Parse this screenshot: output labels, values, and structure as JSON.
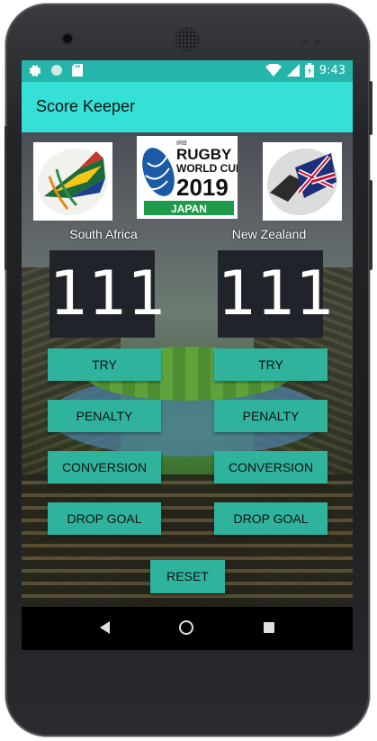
{
  "status_bar": {
    "time": "9:43",
    "left_icons": [
      "gear-icon",
      "circle-icon",
      "sd-card-icon"
    ],
    "right_icons": [
      "wifi-icon",
      "signal-icon",
      "battery-icon"
    ]
  },
  "app_bar": {
    "title": "Score Keeper"
  },
  "logos": {
    "center_lines": [
      "IRB",
      "RUGBY",
      "WORLD CUP",
      "2019",
      "JAPAN"
    ]
  },
  "teams": [
    {
      "name": "South Africa",
      "score": "111"
    },
    {
      "name": "New Zealand",
      "score": "111"
    }
  ],
  "buttons": {
    "try": "TRY",
    "penalty": "PENALTY",
    "conversion": "CONVERSION",
    "drop_goal": "DROP GOAL",
    "reset": "RESET"
  },
  "colors": {
    "status_bar": "#26b5aa",
    "app_bar": "#35e1d6",
    "button": "#2fb39d",
    "score_bg": "#20232a"
  }
}
